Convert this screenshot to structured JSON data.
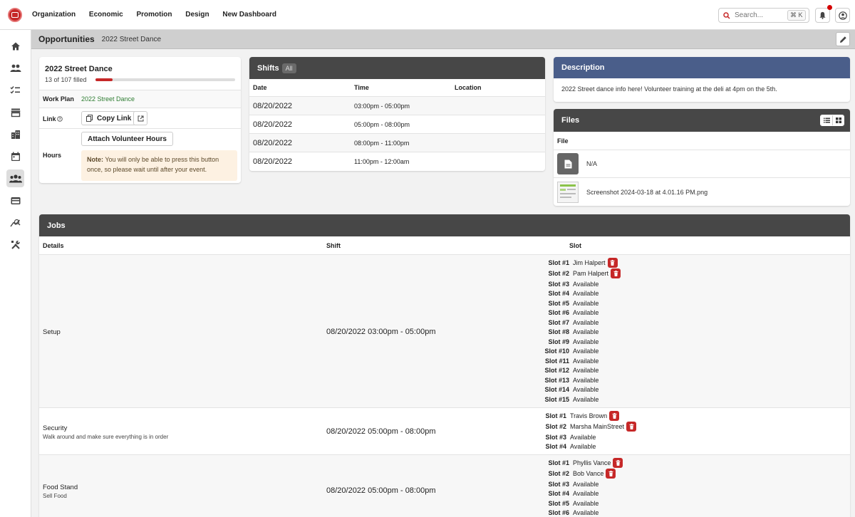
{
  "nav": {
    "items": [
      "Organization",
      "Economic",
      "Promotion",
      "Design",
      "New Dashboard"
    ],
    "search_placeholder": "Search...",
    "search_shortcut": "⌘ K"
  },
  "sidebar": {
    "icons": [
      "home-icon",
      "people-icon",
      "checklist-icon",
      "store-icon",
      "buildings-icon",
      "calendar-icon",
      "groups-icon",
      "card-icon",
      "analytics-icon",
      "tools-icon"
    ],
    "active_index": 6
  },
  "page": {
    "title": "Opportunities",
    "subtitle": "2022 Street Dance"
  },
  "event": {
    "name": "2022 Street Dance",
    "filled_text": "13 of 107 filled",
    "progress": 0.12,
    "work_plan_label": "Work Plan",
    "work_plan_value": "2022 Street Dance",
    "link_label": "Link",
    "copy_link_label": "Copy Link",
    "hours_label": "Hours",
    "attach_label": "Attach Volunteer Hours",
    "note_label": "Note:",
    "note_text": "You will only be able to press this button once, so please wait until after your event."
  },
  "shifts": {
    "title": "Shifts",
    "badge": "All",
    "headers": [
      "Date",
      "Time",
      "Location"
    ],
    "rows": [
      {
        "date": "08/20/2022",
        "time": "03:00pm - 05:00pm",
        "location": ""
      },
      {
        "date": "08/20/2022",
        "time": "05:00pm - 08:00pm",
        "location": ""
      },
      {
        "date": "08/20/2022",
        "time": "08:00pm - 11:00pm",
        "location": ""
      },
      {
        "date": "08/20/2022",
        "time": "11:00pm - 12:00am",
        "location": ""
      }
    ]
  },
  "description": {
    "title": "Description",
    "text": "2022 Street dance info here! Volunteer training at the deli at 4pm on the 5th."
  },
  "files": {
    "title": "Files",
    "header": "File",
    "items": [
      {
        "name": "N/A",
        "icon": "file-icon"
      },
      {
        "name": "Screenshot 2024-03-18 at 4.01.16 PM.png",
        "icon": "image-thumbnail"
      }
    ]
  },
  "jobs": {
    "title": "Jobs",
    "headers": [
      "Details",
      "Shift",
      "Slot"
    ],
    "rows": [
      {
        "name": "Setup",
        "desc": "",
        "shift": "08/20/2022 03:00pm - 05:00pm",
        "slots": [
          {
            "label": "Slot #1",
            "value": "Jim Halpert",
            "filled": true
          },
          {
            "label": "Slot #2",
            "value": "Pam Halpert",
            "filled": true
          },
          {
            "label": "Slot #3",
            "value": "Available",
            "filled": false
          },
          {
            "label": "Slot #4",
            "value": "Available",
            "filled": false
          },
          {
            "label": "Slot #5",
            "value": "Available",
            "filled": false
          },
          {
            "label": "Slot #6",
            "value": "Available",
            "filled": false
          },
          {
            "label": "Slot #7",
            "value": "Available",
            "filled": false
          },
          {
            "label": "Slot #8",
            "value": "Available",
            "filled": false
          },
          {
            "label": "Slot #9",
            "value": "Available",
            "filled": false
          },
          {
            "label": "Slot #10",
            "value": "Available",
            "filled": false
          },
          {
            "label": "Slot #11",
            "value": "Available",
            "filled": false
          },
          {
            "label": "Slot #12",
            "value": "Available",
            "filled": false
          },
          {
            "label": "Slot #13",
            "value": "Available",
            "filled": false
          },
          {
            "label": "Slot #14",
            "value": "Available",
            "filled": false
          },
          {
            "label": "Slot #15",
            "value": "Available",
            "filled": false
          }
        ]
      },
      {
        "name": "Security",
        "desc": "Walk around and make sure everything is in order",
        "shift": "08/20/2022 05:00pm - 08:00pm",
        "slots": [
          {
            "label": "Slot #1",
            "value": "Travis Brown",
            "filled": true
          },
          {
            "label": "Slot #2",
            "value": "Marsha MainStreet",
            "filled": true
          },
          {
            "label": "Slot #3",
            "value": "Available",
            "filled": false
          },
          {
            "label": "Slot #4",
            "value": "Available",
            "filled": false
          }
        ]
      },
      {
        "name": "Food Stand",
        "desc": "Sell Food",
        "shift": "08/20/2022 05:00pm - 08:00pm",
        "slots": [
          {
            "label": "Slot #1",
            "value": "Phyllis Vance",
            "filled": true
          },
          {
            "label": "Slot #2",
            "value": "Bob Vance",
            "filled": true
          },
          {
            "label": "Slot #3",
            "value": "Available",
            "filled": false
          },
          {
            "label": "Slot #4",
            "value": "Available",
            "filled": false
          },
          {
            "label": "Slot #5",
            "value": "Available",
            "filled": false
          },
          {
            "label": "Slot #6",
            "value": "Available",
            "filled": false
          }
        ]
      }
    ]
  }
}
